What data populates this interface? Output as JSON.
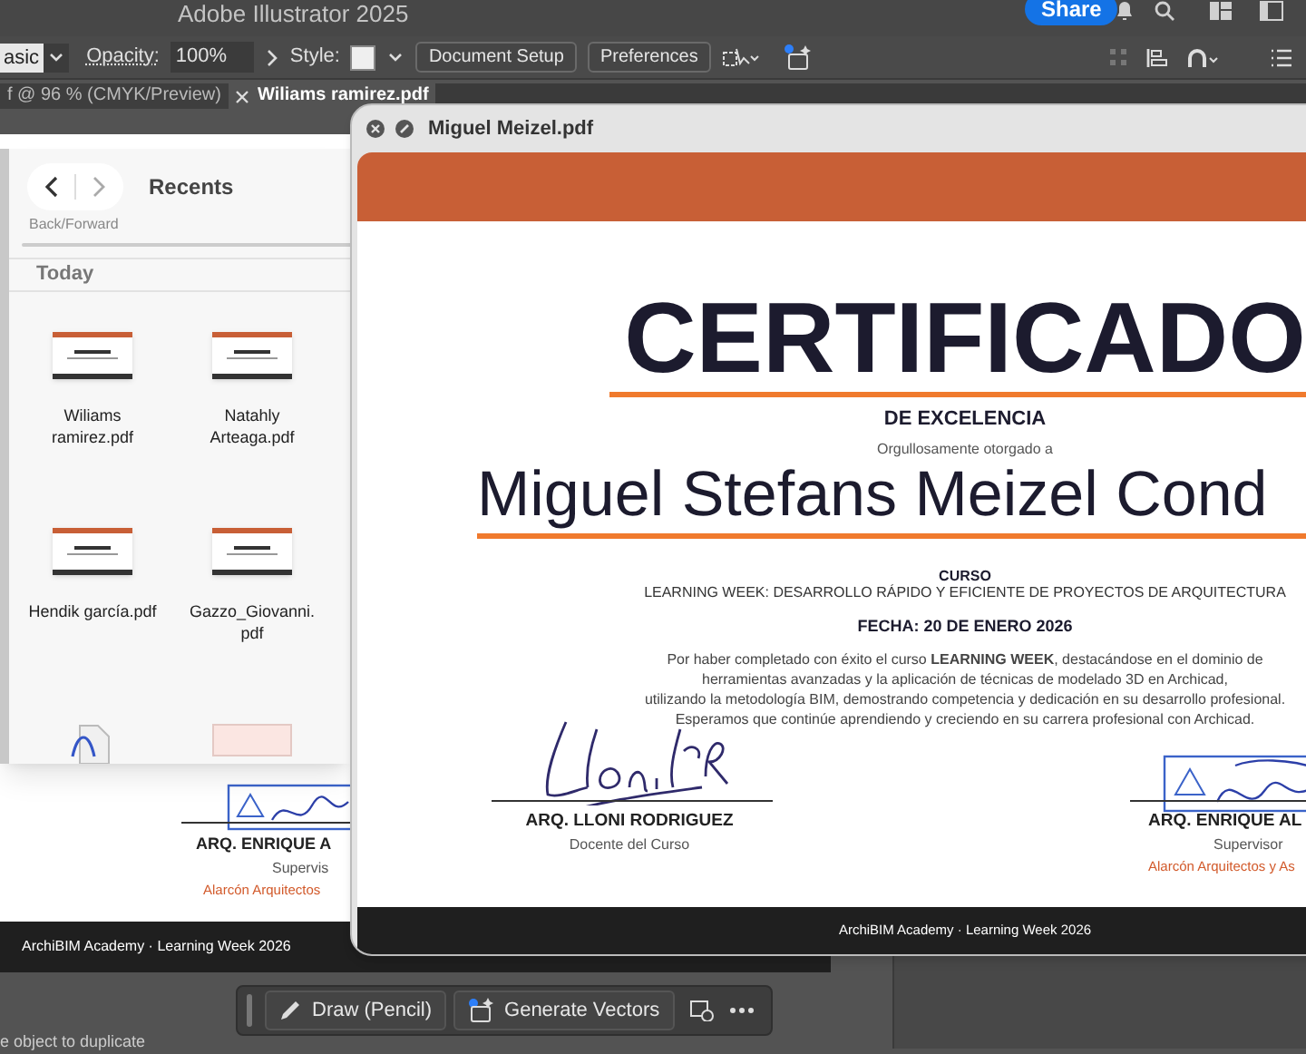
{
  "app": {
    "title": "Adobe Illustrator 2025",
    "share": "Share"
  },
  "control_bar": {
    "preset": "asic",
    "opacity_label": "Opacity:",
    "opacity_value": "100%",
    "style_label": "Style:",
    "buttons": [
      "Document Setup",
      "Preferences"
    ]
  },
  "document_tabs": [
    {
      "label": "f @ 96 % (CMYK/Preview)",
      "selected": false
    },
    {
      "label": "Wiliams ramirez.pdf",
      "selected": true
    }
  ],
  "background_artboard": {
    "signer": "ARQ. ENRIQUE A",
    "role": "Supervis",
    "company": "Alarcón Arquitectos",
    "footer": "ArchiBIM Academy · Learning Week 2026"
  },
  "finder": {
    "title": "Recents",
    "nav_label": "Back/Forward",
    "section": "Today",
    "files": [
      {
        "kind": "certificate",
        "name": "Wiliams ramirez.pdf"
      },
      {
        "kind": "certificate",
        "name": "Natahly Arteaga.pdf"
      },
      {
        "kind": "certificate",
        "name": "Hendik garcía.pdf"
      },
      {
        "kind": "certificate",
        "name": "Gazzo_Giovanni.pdf"
      },
      {
        "kind": "vector"
      },
      {
        "kind": "document"
      }
    ]
  },
  "preview": {
    "title": "Miguel Meizel.pdf",
    "certificate": {
      "heading": "CERTIFICADO",
      "subheading": "DE EXCELENCIA",
      "awarded": "Orgullosamente otorgado a",
      "recipient": "Miguel Stefans Meizel Cond",
      "course_label": "CURSO",
      "course": "LEARNING WEEK: DESARROLLO RÁPIDO Y EFICIENTE DE PROYECTOS DE ARQUITECTURA",
      "date": "FECHA: 20 DE ENERO 2026",
      "body": "Por haber completado con éxito el curso **LEARNING WEEK**, destacándose en el dominio de\nherramientas avanzadas y la aplicación de técnicas de modelado 3D en Archicad,\nutilizando la metodología BIM, demostrando competencia y dedicación en su desarrollo profesional.\nEsperamos que continúe aprendiendo y creciendo en su carrera profesional con Archicad.",
      "signers": [
        {
          "name": "ARQ. LLONI RODRIGUEZ",
          "role": "Docente del Curso",
          "kind": "signature"
        },
        {
          "name": "ARQ. ENRIQUE AL",
          "role": "Supervisor",
          "company": "Alarcón Arquitectos y As",
          "kind": "stamp"
        }
      ],
      "footer": "ArchiBIM Academy · Learning Week 2026"
    }
  },
  "task_bar": {
    "buttons": [
      {
        "kind": "pencil",
        "label": "Draw (Pencil)"
      },
      {
        "kind": "generate",
        "label": "Generate Vectors"
      }
    ]
  },
  "status_text": "e object to duplicate"
}
